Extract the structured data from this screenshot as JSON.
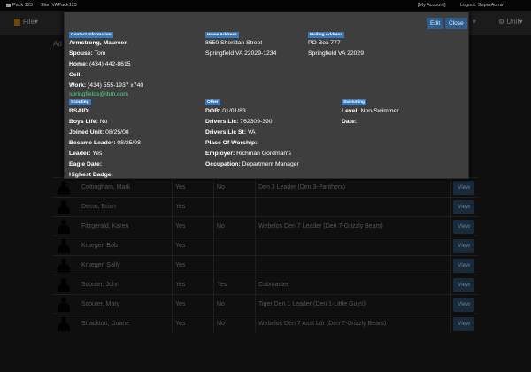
{
  "topbar": {
    "pack": "Pack 123",
    "site": "Site: VAPack123",
    "account": "[My Account]",
    "logout": "Logout: SuperAdmin"
  },
  "nav": {
    "file": "File",
    "unit": "Unit"
  },
  "page_title": "Ad",
  "modal": {
    "edit_label": "Edit",
    "close_label": "Close",
    "contact": {
      "tag": "Contact Information",
      "name": "Armstrong, Maureen",
      "spouse_label": "Spouse:",
      "spouse": "Tom",
      "home_label": "Home:",
      "home": "(434) 442-8615",
      "cell_label": "Cell:",
      "cell": "",
      "work_label": "Work:",
      "work": "(434) 555-1937 x740",
      "email": "springfields@ibm.com"
    },
    "home_address": {
      "tag": "Home Address",
      "line1": "8650 Sheridan Street",
      "line2": "Springfield  VA  22029-1234"
    },
    "mailing_address": {
      "tag": "Mailing Address",
      "line1": "PO Box 777",
      "line2": "Springfield  VA  22029"
    },
    "scouting": {
      "tag": "Scouting",
      "bsaid_label": "BSAID:",
      "bsaid": "",
      "boys_life_label": "Boys Life:",
      "boys_life": "No",
      "joined_label": "Joined Unit:",
      "joined": "08/25/08",
      "leader_date_label": "Became Leader:",
      "leader_date": "08/25/08",
      "leader_label": "Leader:",
      "leader": "Yes",
      "eagle_label": "Eagle Date:",
      "eagle": "",
      "badge_label": "Highest Badge:",
      "badge": ""
    },
    "other": {
      "tag": "Other",
      "dob_label": "DOB:",
      "dob": "01/01/83",
      "lic_label": "Drivers Lic:",
      "lic": "762309-390",
      "lic_st_label": "Drivers Lic St:",
      "lic_st": "VA",
      "worship_label": "Place Of Worship:",
      "worship": "",
      "employer_label": "Employer:",
      "employer": "Richman Gordman's",
      "occupation_label": "Occupation:",
      "occupation": "Department Manager"
    },
    "swimming": {
      "tag": "Swimming",
      "level_label": "Level:",
      "level": "Non-Swimmer",
      "date_label": "Date:",
      "date": ""
    }
  },
  "rows": [
    {
      "name": "Cottingham, Mark",
      "c1": "Yes",
      "c2": "No",
      "c3": "Den 3 Leader (Den 3-Panthers)",
      "view": "View"
    },
    {
      "name": "Demo, Brian",
      "c1": "Yes",
      "c2": "",
      "c3": "",
      "view": "View"
    },
    {
      "name": "Fitzgerald, Karen",
      "c1": "Yes",
      "c2": "No",
      "c3": "Webelos Den 7 Leader (Den 7-Grizzly Bears)",
      "view": "View"
    },
    {
      "name": "Krueger, Bob",
      "c1": "Yes",
      "c2": "",
      "c3": "",
      "view": "View"
    },
    {
      "name": "Krueger, Sally",
      "c1": "Yes",
      "c2": "",
      "c3": "",
      "view": "View"
    },
    {
      "name": "Scouter, John",
      "c1": "Yes",
      "c2": "Yes",
      "c3": "Cubmaster",
      "view": "View"
    },
    {
      "name": "Scouter, Mary",
      "c1": "Yes",
      "c2": "No",
      "c3": "Tiger Den 1 Leader (Den 1-Little Guys)",
      "view": "View"
    },
    {
      "name": "Strackton, Duane",
      "c1": "Yes",
      "c2": "No",
      "c3": "Webelos Den 7 Asst Ldr (Den 7-Grizzly Bears)",
      "view": "View"
    }
  ]
}
